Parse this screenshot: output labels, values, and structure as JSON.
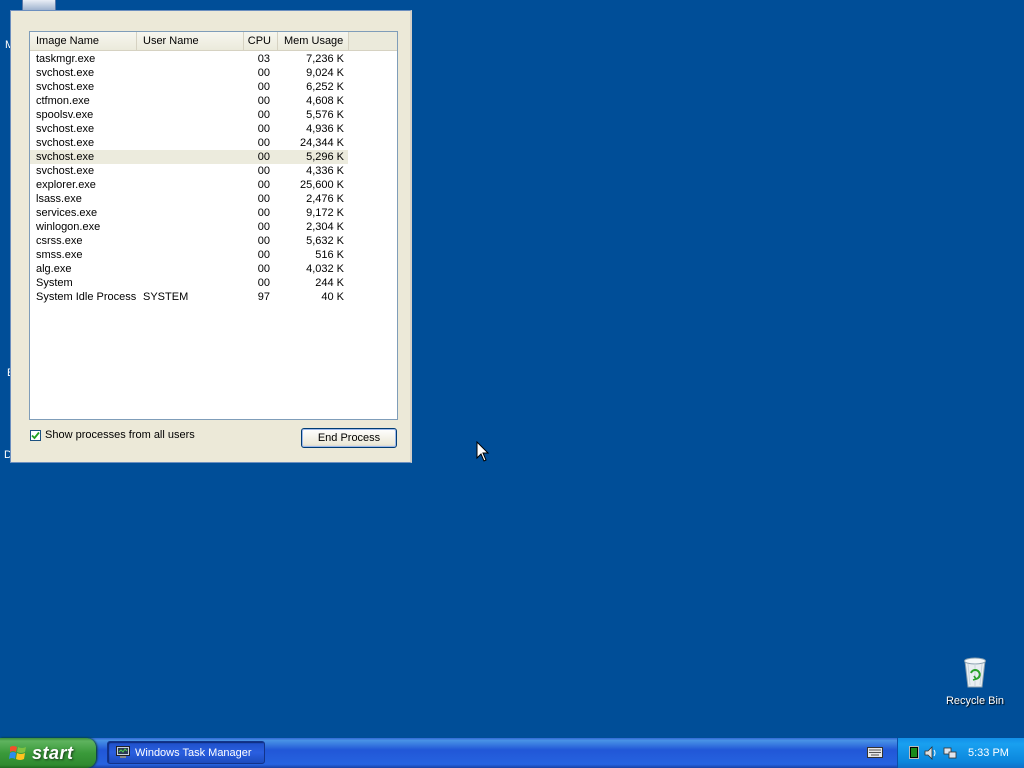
{
  "desktop": {
    "left_fragments": [
      "M",
      "E",
      "D"
    ]
  },
  "task_manager": {
    "columns": {
      "image_name": "Image Name",
      "user_name": "User Name",
      "cpu": "CPU",
      "mem_usage": "Mem Usage"
    },
    "processes": [
      {
        "name": "taskmgr.exe",
        "user": "",
        "cpu": "03",
        "mem": "7,236 K"
      },
      {
        "name": "svchost.exe",
        "user": "",
        "cpu": "00",
        "mem": "9,024 K"
      },
      {
        "name": "svchost.exe",
        "user": "",
        "cpu": "00",
        "mem": "6,252 K"
      },
      {
        "name": "ctfmon.exe",
        "user": "",
        "cpu": "00",
        "mem": "4,608 K"
      },
      {
        "name": "spoolsv.exe",
        "user": "",
        "cpu": "00",
        "mem": "5,576 K"
      },
      {
        "name": "svchost.exe",
        "user": "",
        "cpu": "00",
        "mem": "4,936 K"
      },
      {
        "name": "svchost.exe",
        "user": "",
        "cpu": "00",
        "mem": "24,344 K"
      },
      {
        "name": "svchost.exe",
        "user": "",
        "cpu": "00",
        "mem": "5,296 K",
        "selected": true
      },
      {
        "name": "svchost.exe",
        "user": "",
        "cpu": "00",
        "mem": "4,336 K"
      },
      {
        "name": "explorer.exe",
        "user": "",
        "cpu": "00",
        "mem": "25,600 K"
      },
      {
        "name": "lsass.exe",
        "user": "",
        "cpu": "00",
        "mem": "2,476 K"
      },
      {
        "name": "services.exe",
        "user": "",
        "cpu": "00",
        "mem": "9,172 K"
      },
      {
        "name": "winlogon.exe",
        "user": "",
        "cpu": "00",
        "mem": "2,304 K"
      },
      {
        "name": "csrss.exe",
        "user": "",
        "cpu": "00",
        "mem": "5,632 K"
      },
      {
        "name": "smss.exe",
        "user": "",
        "cpu": "00",
        "mem": "516 K"
      },
      {
        "name": "alg.exe",
        "user": "",
        "cpu": "00",
        "mem": "4,032 K"
      },
      {
        "name": "System",
        "user": "",
        "cpu": "00",
        "mem": "244 K"
      },
      {
        "name": "System Idle Process",
        "user": "SYSTEM",
        "cpu": "97",
        "mem": "40 K"
      }
    ],
    "show_all_users": {
      "label": "Show processes from all users",
      "checked": true
    },
    "end_process_label": "End Process"
  },
  "desktop_icons": {
    "recycle_bin": {
      "label": "Recycle Bin",
      "icon": "recycle-bin-icon"
    }
  },
  "taskbar": {
    "start_label": "start",
    "task_button_label": "Windows Task Manager",
    "clock": "5:33 PM",
    "tray_icons": [
      "cpu-meter-icon",
      "volume-icon",
      "network-icon"
    ]
  },
  "colors": {
    "desktop": "#004e98",
    "window_face": "#ece9d8",
    "start_green": "#3a9a3a",
    "taskbar_blue": "#2157d7",
    "tray_blue": "#0b86dc"
  }
}
